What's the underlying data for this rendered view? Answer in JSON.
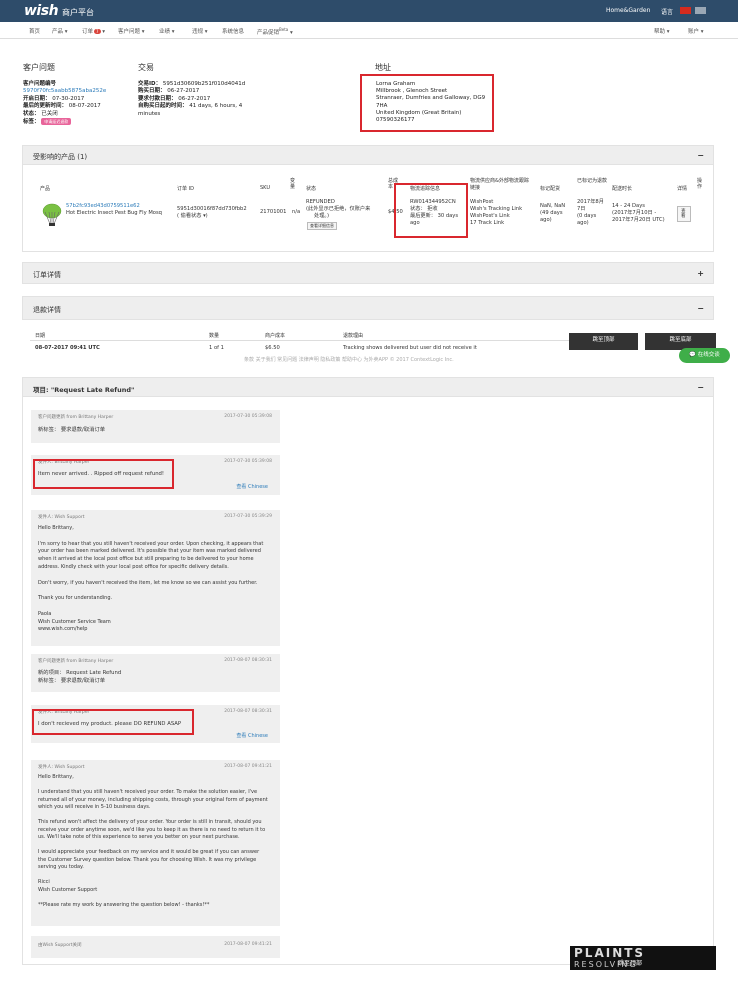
{
  "header": {
    "logo": "wish",
    "subtitle": "商户平台",
    "store_name": "Home&Garden",
    "language": "语言"
  },
  "nav": {
    "items": [
      "首页",
      "产品 ▾",
      "订单",
      "客户问题 ▾",
      "业绩 ▾",
      "违规 ▾",
      "系统信息",
      "产品促销"
    ],
    "orders_badge": "7",
    "promo_badge": "Beta",
    "right_items": [
      "帮助 ▾",
      "账户 ▾"
    ]
  },
  "customer_issue": {
    "title": "客户问题",
    "id_label": "客户问题编号",
    "id_value": "5970f70fc5aabb5875aba252e",
    "open_label": "开启日期：",
    "open_value": "07-30-2017",
    "updated_label": "最后的更新时间：",
    "updated_value": "08-07-2017",
    "status_label": "状态：",
    "status_value": "已关闭",
    "tag_label": "标签：",
    "tag_value": "申请延迟退款"
  },
  "transaction": {
    "title": "交易",
    "tid_label": "交易ID：",
    "tid_value": "5951d30609b251f010d4041d",
    "buy_label": "购买日期：",
    "buy_value": "06-27-2017",
    "req_label": "要求付款日期：",
    "req_value": "06-27-2017",
    "elapsed_label": "自购买日起的时间：",
    "elapsed_value": "41 days, 6 hours, 4",
    "elapsed_value2": "minutes"
  },
  "address": {
    "title": "地址",
    "lines": [
      "Lorna Graham",
      "Millbrook , Glenoch Street",
      "Stranraer, Dumfries and Galloway, DG9",
      "7HA",
      "United Kingdom (Great Britain)",
      "07590326177"
    ]
  },
  "products": {
    "title": "受影响的产品 (1)",
    "toggle": "−",
    "columns": [
      "产品",
      "订单 ID",
      "SKU",
      "变量",
      "状态",
      "总成本",
      "物流追踪信息",
      "物流供应商&外部物流跟踪链接",
      "标记配货",
      "已标记为退款",
      "配送时长",
      "详情",
      "操作"
    ],
    "row": {
      "product_id": "57b2fc93ed43d0759511e62",
      "product_name": "Hot Electric Insect Pest Bug Fly Mosq",
      "order_id": "5951d30016f87dd730fbb2",
      "order_link": "( 偷看状态 ▾)",
      "sku": "21701001",
      "variant": "n/a",
      "status_1": "REFUNDED",
      "status_2": "(此外显示已拒绝，仅账户来",
      "status_3": "处理。)",
      "status_btn": "查看详细信息",
      "cost": "$4.50",
      "tracking_no": "RW014344952CN",
      "tracking_status": "状态： 拒收",
      "tracking_update": "最后更新： 30 days",
      "tracking_update2": "ago",
      "carrier": "WishPost",
      "carrier_link1": "Wish's Tracking Link",
      "carrier_link2": "WishPost's Link",
      "carrier_link3": "17 Track Link",
      "marked": "NaN, NaN",
      "marked2": "(49 days",
      "marked3": "ago)",
      "refund_date": "2017年8月",
      "refund_date2": "7日",
      "refund_date3": "(0 days",
      "refund_date4": "ago)",
      "ship_time": "14 - 24 Days",
      "ship_time2": "(2017年7月10日 -",
      "ship_time3": "2017年7月20日 UTC)",
      "detail_btn": "查看"
    }
  },
  "order_details": {
    "title": "订单详情",
    "toggle": "+"
  },
  "refund_details": {
    "title": "退款详情",
    "toggle": "−",
    "columns": [
      "日期",
      "数量",
      "商户成本",
      "退款理由"
    ],
    "row": [
      "08-07-2017 09:41 UTC",
      "1 of 1",
      "$6.50",
      "Tracking shows delivered but user did not receive it"
    ],
    "btn_next": "跳至顶部",
    "btn_top": "跳至底部"
  },
  "footer": {
    "links": "条款  关于我们  常见问题  法律声明  隐私政策  帮助中心  为外卖APP  © 2017 ContextLogic Inc."
  },
  "chat": {
    "label": "在线交谈"
  },
  "item_panel": {
    "title": "项目: \"Request Late Refund\"",
    "toggle": "−"
  },
  "messages": [
    {
      "header": "客户问题更新 from Brittany Harper",
      "date": "2017-07-30 05:39:08",
      "body": "新标签： 要求退款/取消订单",
      "translate": ""
    },
    {
      "header": "发件人: Brittany Harper",
      "date": "2017-07-30 05:39:08",
      "body": "Item never arrived. . Ripped off request refund!",
      "translate": "查看 Chinese"
    },
    {
      "header": "发件人: Wish Support",
      "date": "2017-07-30 05:39:29",
      "body": "Hello Brittany,\n\nI'm sorry to hear that you still haven't received your order. Upon checking, it appears that\nyour order has been marked delivered. It's possible that your item was marked delivered\nwhen it arrived at the local post office but still preparing to be delivered to your home\naddress. Kindly check with your local post office for specific delivery details.\n\nDon't worry, if you haven't received the item, let me know so we can assist you further.\n\nThank you for understanding.\n\nPaola\nWish Customer Service Team\nwww.wish.com/help",
      "translate": ""
    },
    {
      "header": "客户问题更新 from Brittany Harper",
      "date": "2017-08-07 08:30:31",
      "body": "新的项目： Request Late Refund\n新标签： 要求退款/取消订单",
      "translate": ""
    },
    {
      "header": "发件人: Brittany Harper",
      "date": "2017-08-07 08:30:31",
      "body": "I don't recieved my product. please DO REFUND ASAP",
      "translate": "查看 Chinese"
    },
    {
      "header": "发件人: Wish Support",
      "date": "2017-08-07 09:41:21",
      "body": "Hello Brittany,\n\nI understand that you still haven't received your order. To make the solution easier, I've\nreturned all of your money, including shipping costs, through your original form of payment\nwhich you will receive in 5-10 business days.\n\nThis refund won't affect the delivery of your order. Your order is still in transit, should you\nreceive your order anytime soon, we'd like you to keep it as there is no need to return it to\nus. We'll take note of this experience to serve you better on your next purchase.\n\nI would appreciate your feedback on my service and it would be great if you can answer\nthe Customer Survey question below. Thank you for choosing Wish. It was my privilege\nserving you today.\n\nRicci\nWish Customer Support\n\n**Please rate my work by answering the question below! - thanks!**",
      "translate": ""
    },
    {
      "header": "由Wish Support关闭",
      "date": "2017-08-07 09:41:21",
      "body": "",
      "translate": ""
    }
  ],
  "watermark": {
    "line1": "PLAINTS",
    "line2": "RESOLVING",
    "btn": "跳至顶部"
  },
  "colors": {
    "topbar": "#2e4c6a",
    "link": "#2b7bb9",
    "highlight": "#d9272e",
    "chat": "#3fae49"
  }
}
